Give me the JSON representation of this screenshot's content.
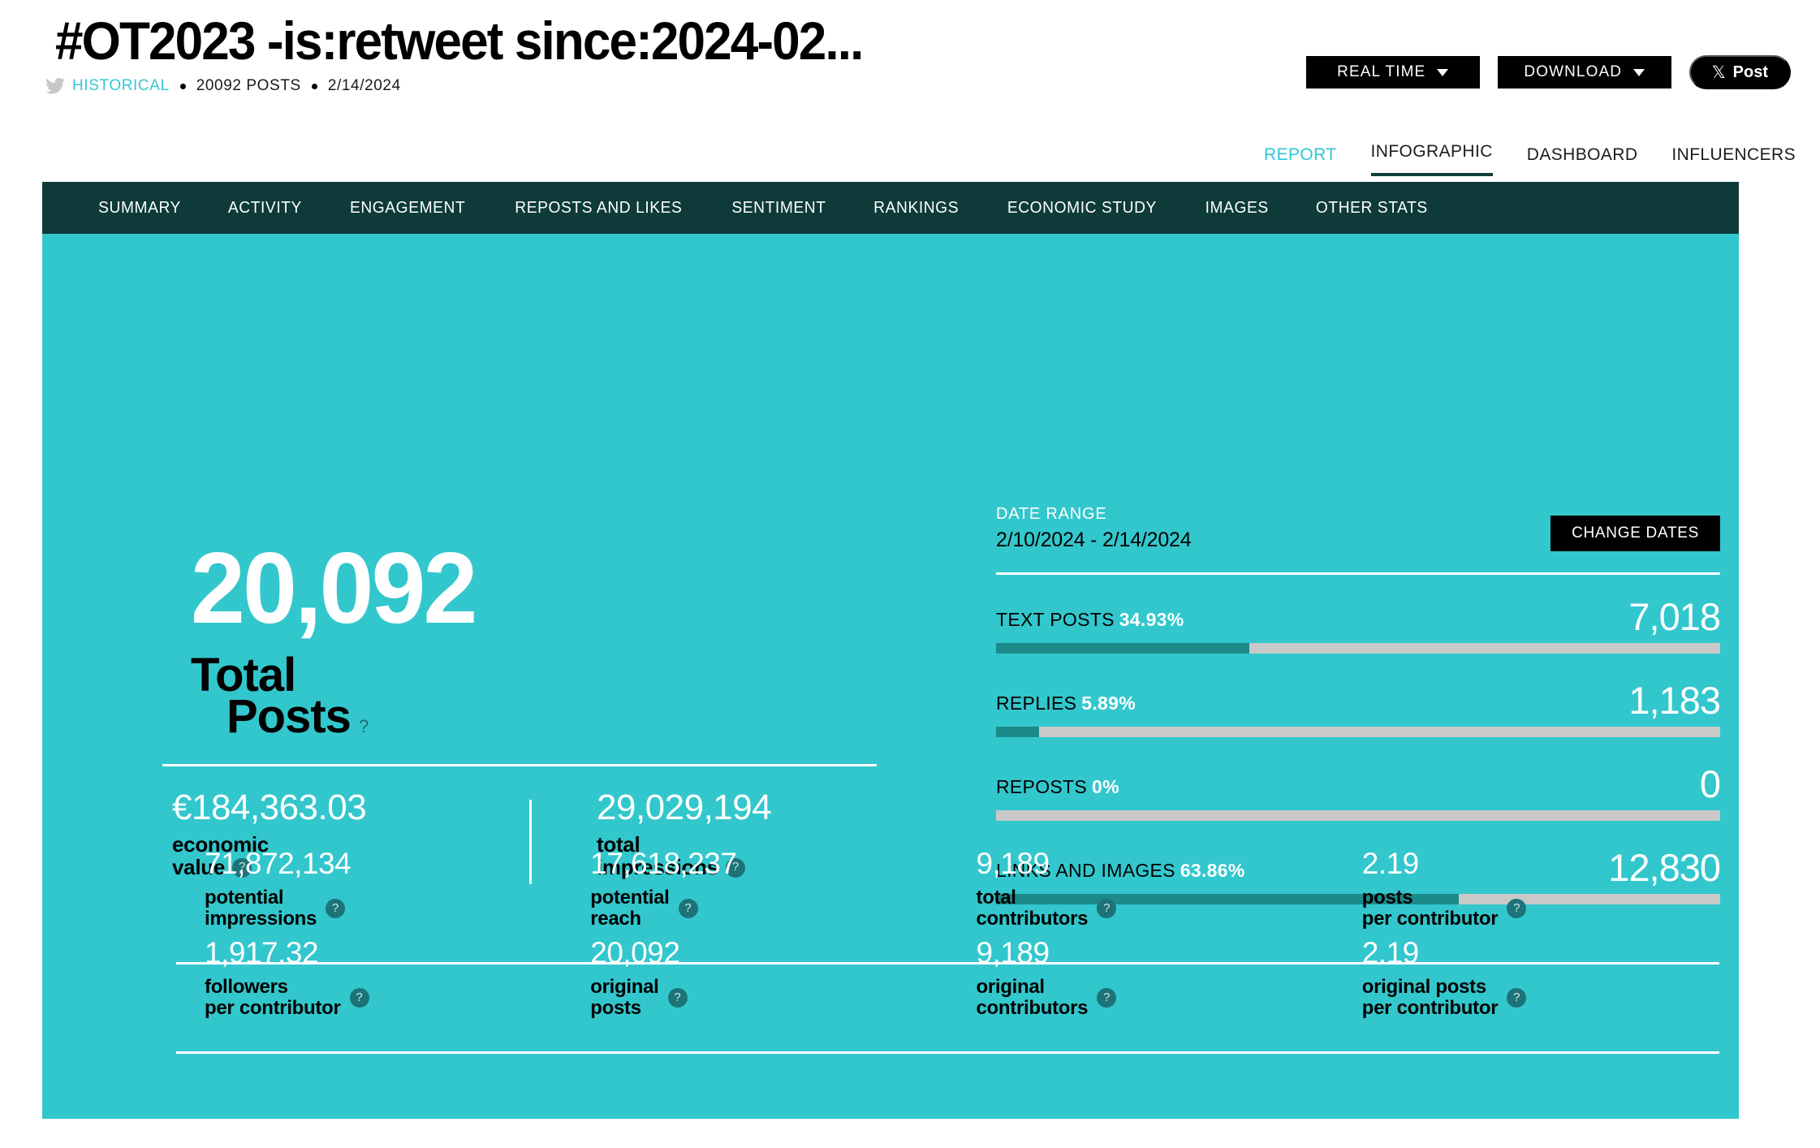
{
  "header": {
    "title": "#OT2023 -is:retweet since:2024-02...",
    "subtitle": {
      "source": "HISTORICAL",
      "posts": "20092 POSTS",
      "date": "2/14/2024"
    },
    "actions": {
      "real_time": "REAL TIME",
      "download": "DOWNLOAD",
      "post": "Post",
      "x_glyph": "𝕏"
    },
    "tabs": [
      {
        "label": "REPORT",
        "active": true,
        "underlined": false
      },
      {
        "label": "INFOGRAPHIC",
        "active": false,
        "underlined": true
      },
      {
        "label": "DASHBOARD",
        "active": false,
        "underlined": false
      },
      {
        "label": "INFLUENCERS",
        "active": false,
        "underlined": false
      }
    ]
  },
  "subnav": [
    "SUMMARY",
    "ACTIVITY",
    "ENGAGEMENT",
    "REPOSTS AND LIKES",
    "SENTIMENT",
    "RANKINGS",
    "ECONOMIC STUDY",
    "IMAGES",
    "OTHER STATS"
  ],
  "hero": {
    "total_value": "20,092",
    "label_line1": "Total",
    "label_line2": "Posts",
    "help": "?"
  },
  "pair_stats": [
    {
      "value": "€184,363.03",
      "label_line1": "economic",
      "label_line2": "value"
    },
    {
      "value": "29,029,194",
      "label_line1": "total",
      "label_line2": "impressions"
    }
  ],
  "date_range": {
    "label": "DATE RANGE",
    "value": "2/10/2024 - 2/14/2024",
    "change_button": "CHANGE DATES"
  },
  "breakdown": [
    {
      "label": "TEXT POSTS",
      "percent": "34.93%",
      "count": "7,018",
      "fill": 34.93
    },
    {
      "label": "REPLIES",
      "percent": "5.89%",
      "count": "1,183",
      "fill": 5.89
    },
    {
      "label": "REPOSTS",
      "percent": "0%",
      "count": "0",
      "fill": 0
    },
    {
      "label": "LINKS AND IMAGES",
      "percent": "63.86%",
      "count": "12,830",
      "fill": 63.86
    }
  ],
  "metrics_row1": [
    {
      "value": "71,872,134",
      "label": "potential\nimpressions"
    },
    {
      "value": "17,618,237",
      "label": "potential\nreach"
    },
    {
      "value": "9,189",
      "label": "total\ncontributors"
    },
    {
      "value": "2.19",
      "label": "posts\nper contributor"
    }
  ],
  "metrics_row2": [
    {
      "value": "1,917.32",
      "label": "followers\nper contributor"
    },
    {
      "value": "20,092",
      "label": "original\nposts"
    },
    {
      "value": "9,189",
      "label": "original\ncontributors"
    },
    {
      "value": "2.19",
      "label": "original posts\nper contributor"
    }
  ],
  "help_badge": "?",
  "colors": {
    "panel_teal": "#32c7cd",
    "subnav_dark": "#0e3a3a",
    "bar_fill": "#1d8a8a",
    "bar_track": "#c9c9c9",
    "accent_cyan": "#36c7d4",
    "black": "#000000",
    "white": "#ffffff"
  }
}
